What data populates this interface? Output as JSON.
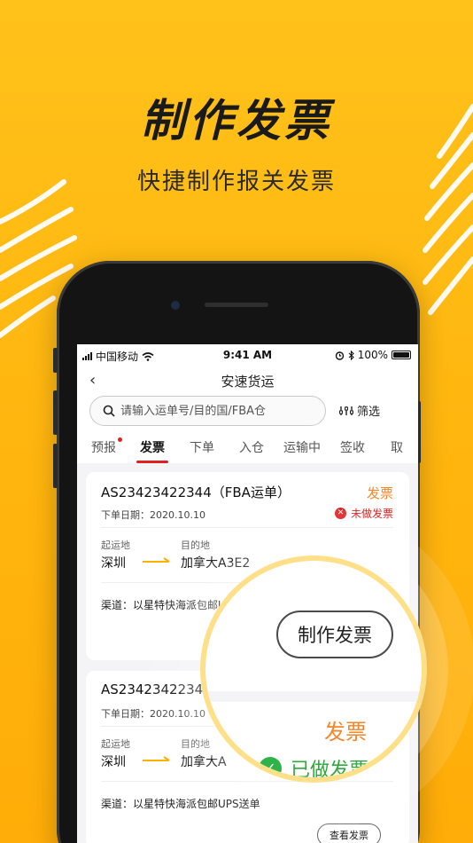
{
  "hero": {
    "title": "制作发票",
    "subtitle": "快捷制作报关发票"
  },
  "statusbar": {
    "carrier": "中国移动",
    "time": "9:41 AM",
    "battery": "100%"
  },
  "navbar": {
    "back_icon": "‹",
    "title": "安速货运"
  },
  "search": {
    "placeholder": "请输入运单号/目的国/FBA仓",
    "filter_label": "筛选"
  },
  "tabs": [
    {
      "label": "预报",
      "dot": true
    },
    {
      "label": "发票",
      "active": true
    },
    {
      "label": "下单"
    },
    {
      "label": "入仓"
    },
    {
      "label": "运输中"
    },
    {
      "label": "签收"
    },
    {
      "label": "取"
    }
  ],
  "orders": [
    {
      "order_no": "AS23423422344（FBA运单）",
      "type": "发票",
      "date_label": "下单日期：2020.10.10",
      "status": "未做发票",
      "from_label": "起运地",
      "to_label": "目的地",
      "from": "深圳",
      "to": "加拿大A3E2",
      "channel": "渠道：以星特快海派包邮UPS送"
    },
    {
      "order_no": "AS23423422344",
      "date_label": "下单日期：2020.10.10",
      "from_label": "起运地",
      "to_label": "目的地",
      "from": "深圳",
      "to": "加拿大A",
      "channel": "渠道：以星特快海派包邮UPS送单",
      "action": "查看发票"
    }
  ],
  "magnifier": {
    "make_invoice_button": "制作发票",
    "type": "发票",
    "status": "已做发票"
  },
  "colors": {
    "accent_orange": "#f5862a",
    "tab_red": "#e02020",
    "success_green": "#2faa3a",
    "bg_yellow": "#ffb50e"
  }
}
